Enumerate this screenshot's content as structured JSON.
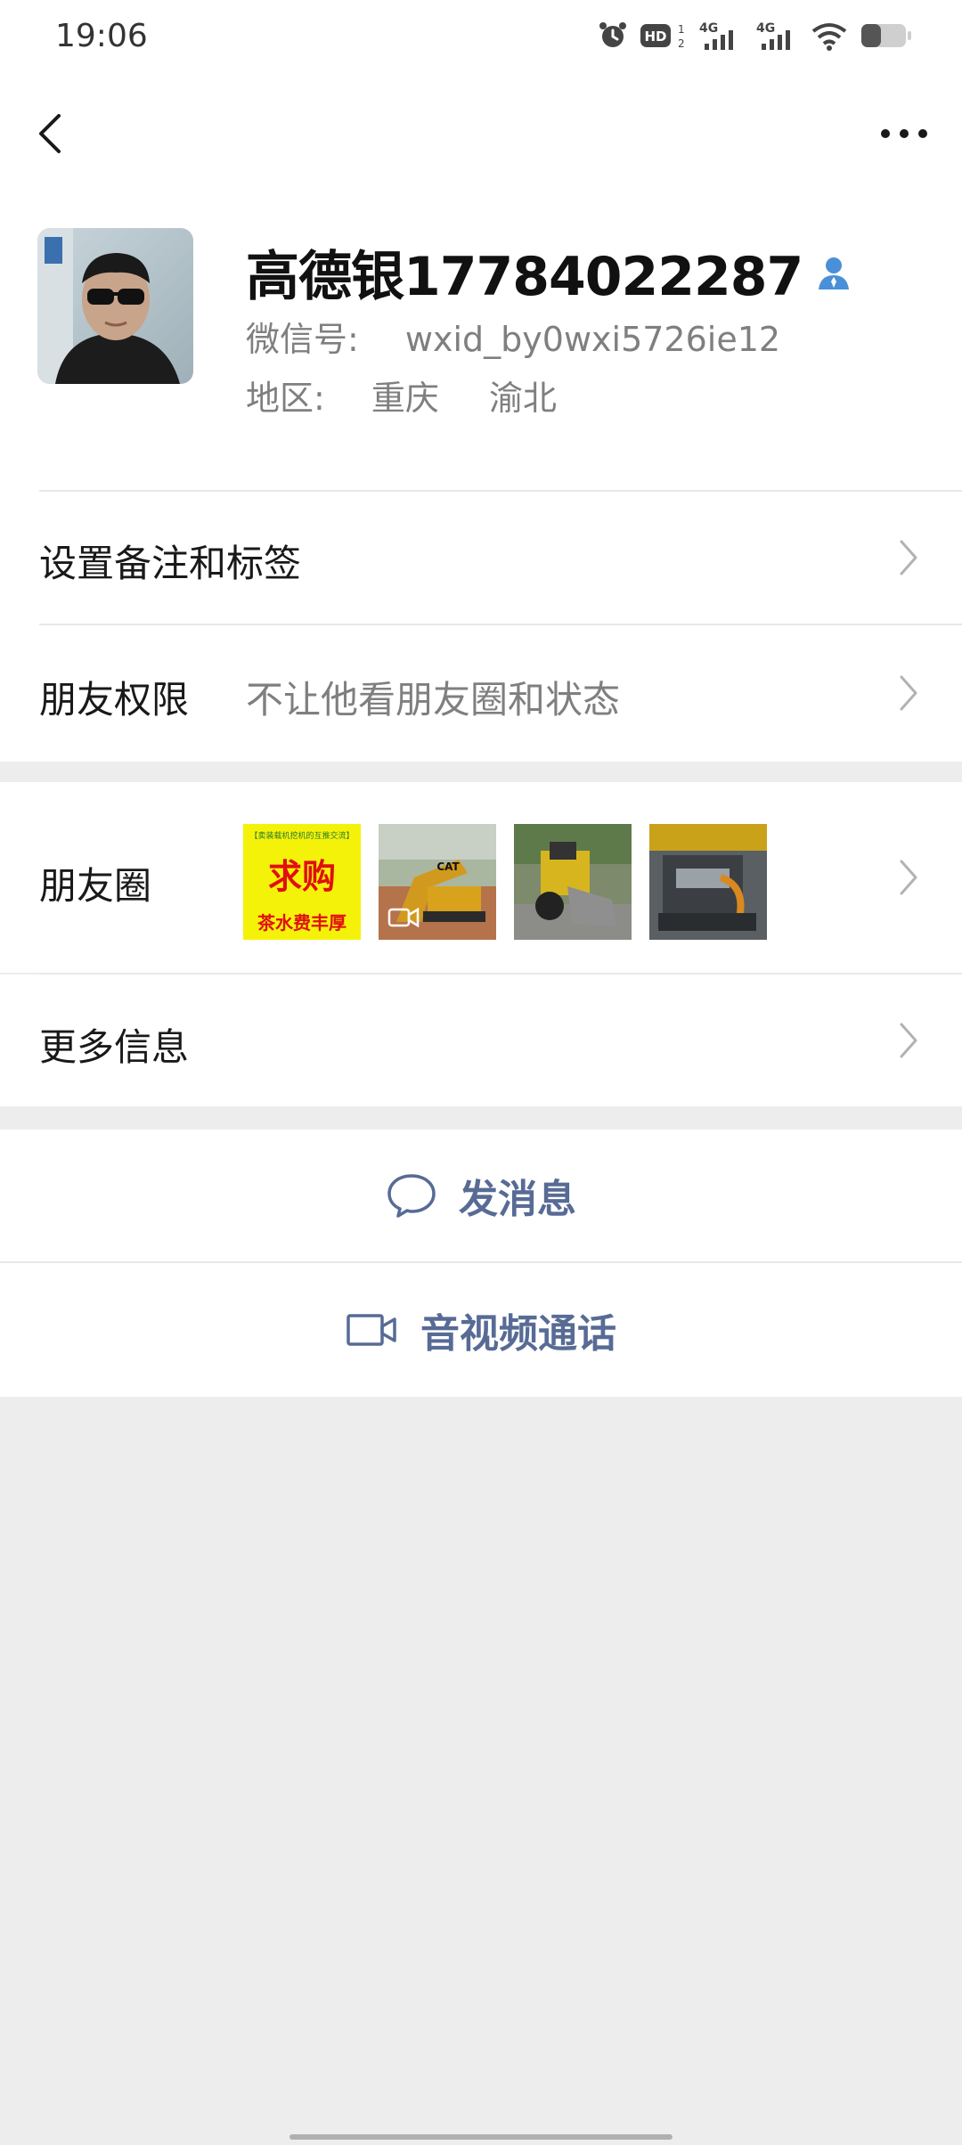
{
  "status_bar": {
    "time": "19:06",
    "hd_label": "HD",
    "sim1_label": "4G",
    "sim2_label": "4G"
  },
  "nav": {
    "back_icon": "chevron-left-icon",
    "more_icon": "more-horizontal-icon"
  },
  "profile": {
    "name": "高德银17784022287",
    "wechat_id_label": "微信号:",
    "wechat_id_value": "wxid_by0wxi5726ie12",
    "region_label": "地区:",
    "region_city": "重庆",
    "region_district": "渝北"
  },
  "rows": {
    "remark": {
      "label": "设置备注和标签"
    },
    "permissions": {
      "label": "朋友权限",
      "value": "不让他看朋友圈和状态"
    },
    "moments": {
      "label": "朋友圈",
      "thumb1_top": "【卖装载机挖机的互推交流】",
      "thumb1_main": "求购",
      "thumb1_bottom": "茶水费丰厚",
      "thumb2_brand": "CAT"
    },
    "more_info": {
      "label": "更多信息"
    }
  },
  "actions": {
    "message": "发消息",
    "call": "音视频通话"
  },
  "colors": {
    "accent": "#576b95",
    "background": "#ededed",
    "divider": "#e8e8e8"
  }
}
